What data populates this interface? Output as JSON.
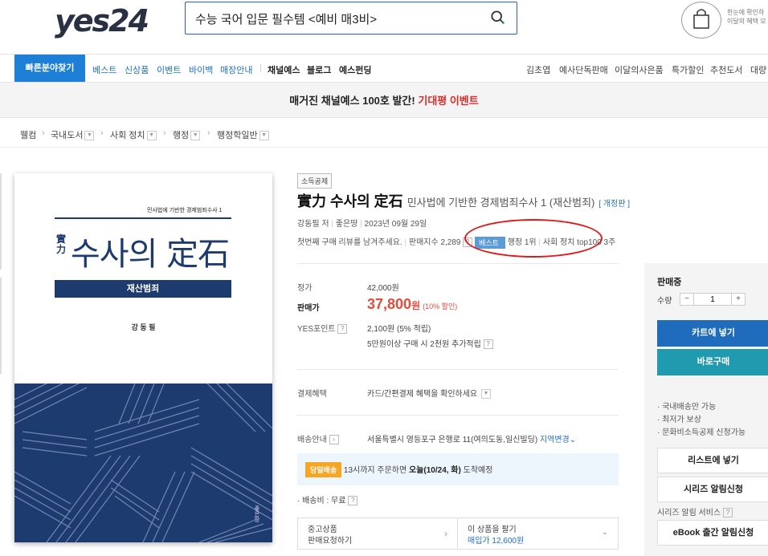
{
  "header": {
    "logo": "yes24",
    "search_value": "수능 국어 입문 필수템 <예비 매3비>",
    "promo_line1": "한눈에 확인하",
    "promo_line2": "이달의 혜택 모"
  },
  "nav": {
    "quick_find": "빠른분야찾기",
    "items_blue": [
      "베스트",
      "신상품",
      "이벤트",
      "바이백",
      "매장안내"
    ],
    "items_bold": [
      "채널예스",
      "블로그",
      "예스펀딩"
    ],
    "items_right": [
      "김초엽",
      "예사단독판매",
      "이달의사은품",
      "특가할인",
      "추천도서",
      "대량"
    ]
  },
  "banner": {
    "text": "매거진 채널예스 100호 발간!",
    "highlight": "기대평 이벤트"
  },
  "breadcrumb": [
    "웰컴",
    "국내도서",
    "사회 정치",
    "행정",
    "행정학일반"
  ],
  "cover": {
    "series": "민사법에 기반한 경제범죄수사 1",
    "hanja": "實力",
    "main": "수사의 定石",
    "band": "재산범죄",
    "author": "강 동 필",
    "publisher": "좋은땅"
  },
  "product": {
    "badge": "소득공제",
    "title": "實力 수사의 定石",
    "subtitle": "민사법에 기반한 경제범죄수사 1 (재산범죄)",
    "revision": "[ 개정판 ]",
    "author": "강동필 저",
    "publisher": "좋은땅",
    "date": "2023년 09월 29일",
    "review_prompt": "첫번째 구매 리뷰를 남겨주세요.",
    "sales_index": "판매지수 2,289",
    "best_badge": "베스트",
    "rank": "행정 1위",
    "rank2": "사회 정치 top100 3주"
  },
  "price": {
    "list_label": "정가",
    "list_value": "42,000원",
    "sale_label": "판매가",
    "sale_value": "37,800",
    "won": "원",
    "discount": "(10% 할인)",
    "points_label": "YES포인트",
    "points_value": "2,100원 (5% 적립)",
    "points_extra": "5만원이상 구매 시 2천원 추가적립",
    "payment_label": "결제혜택",
    "payment_value": "카드/간편결제 혜택을 확인하세요",
    "delivery_label": "배송안내",
    "delivery_addr": "서울특별시 영등포구 은행로 11(여의도동,일신빌딩)",
    "region_change": "지역변경",
    "sameday_tag": "당일배송",
    "sameday_text": "13시까지 주문하면",
    "sameday_bold": "오늘(10/24, 화)",
    "sameday_end": "도착예정",
    "shipping_fee": "배송비 : 무료",
    "used_label": "중고상품",
    "used_sub": "판매요청하기",
    "sell_label": "이 상품을 팔기",
    "sell_sub": "매입가 12,600원"
  },
  "side": {
    "status": "판매중",
    "qty_label": "수량",
    "qty_value": "1",
    "cart": "카트에 넣기",
    "buy_now": "바로구매",
    "notes": [
      "국내배송만 가능",
      "최저가 보상",
      "문화비소득공제 신청가능"
    ],
    "wishlist": "리스트에 넣기",
    "series_alert": "시리즈 알림신청",
    "series_service": "시리즈 알림 서비스",
    "ebook_alert": "eBook 출간 알림신청"
  },
  "colors": {
    "accent_blue": "#1e7fd6",
    "sale_red": "#e84a3a",
    "teal": "#1f9aae"
  }
}
